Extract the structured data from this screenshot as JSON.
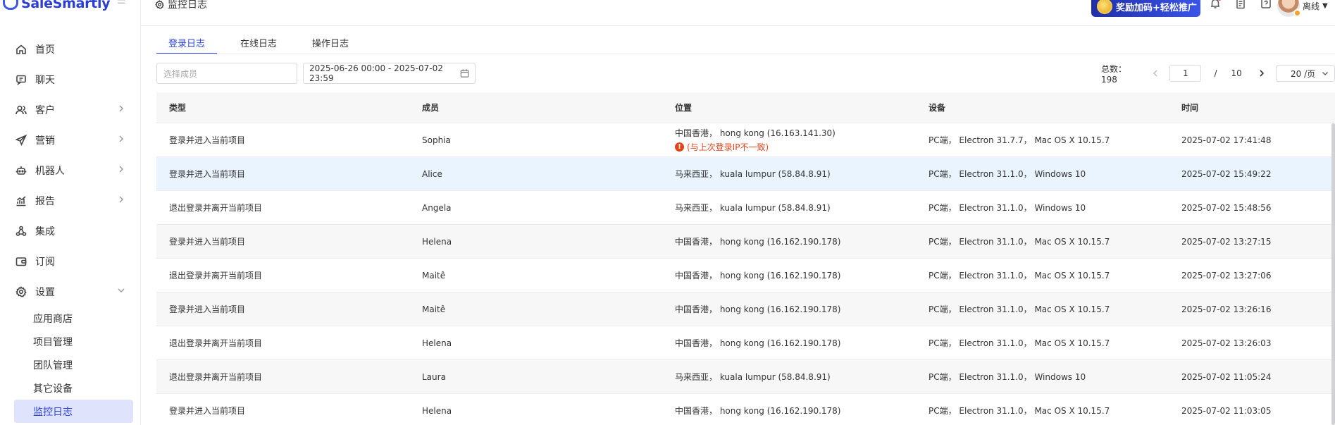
{
  "app": {
    "name": "SaleSmartly"
  },
  "sidebar": {
    "items": [
      {
        "label": "首页",
        "icon": "home-icon",
        "arrow": false
      },
      {
        "label": "聊天",
        "icon": "chat-icon",
        "arrow": false
      },
      {
        "label": "客户",
        "icon": "users-icon",
        "arrow": true
      },
      {
        "label": "营销",
        "icon": "send-icon",
        "arrow": true
      },
      {
        "label": "机器人",
        "icon": "robot-icon",
        "arrow": true
      },
      {
        "label": "报告",
        "icon": "report-icon",
        "arrow": true
      },
      {
        "label": "集成",
        "icon": "integration-icon",
        "arrow": false
      },
      {
        "label": "订阅",
        "icon": "wallet-icon",
        "arrow": false
      },
      {
        "label": "设置",
        "icon": "gear-icon",
        "arrow": "down"
      }
    ],
    "settings_sub": [
      {
        "label": "应用商店",
        "active": false
      },
      {
        "label": "项目管理",
        "active": false
      },
      {
        "label": "团队管理",
        "active": false
      },
      {
        "label": "其它设备",
        "active": false
      },
      {
        "label": "监控日志",
        "active": true
      }
    ]
  },
  "header": {
    "breadcrumb": "监控日志",
    "promo": "奖励加码+轻松推广",
    "status": "离线"
  },
  "tabs": [
    {
      "label": "登录日志",
      "active": true
    },
    {
      "label": "在线日志",
      "active": false
    },
    {
      "label": "操作日志",
      "active": false
    }
  ],
  "filters": {
    "member_placeholder": "选择成员",
    "date_range": "2025-06-26 00:00 - 2025-07-02 23:59"
  },
  "pager": {
    "total_label": "总数：198",
    "current": "1",
    "sep": "/",
    "pages": "10",
    "size": "20 /页"
  },
  "table": {
    "headers": [
      "类型",
      "成员",
      "位置",
      "设备",
      "时间"
    ],
    "rows": [
      {
        "type": "登录并进入当前项目",
        "member": "Sophia",
        "location": "中国香港，  hong kong (16.163.141.30)",
        "warning": "(与上次登录IP不一致)",
        "device": "PC端，  Electron 31.7.7，  Mac OS X 10.15.7",
        "time": "2025-07-02 17:41:48"
      },
      {
        "type": "登录并进入当前项目",
        "member": "Alice",
        "location": "马来西亚，  kuala lumpur (58.84.8.91)",
        "warning": "",
        "device": "PC端，  Electron 31.1.0，  Windows 10",
        "time": "2025-07-02 15:49:22"
      },
      {
        "type": "退出登录并离开当前项目",
        "member": "Angela",
        "location": "马来西亚，  kuala lumpur (58.84.8.91)",
        "warning": "",
        "device": "PC端，  Electron 31.1.0，  Windows 10",
        "time": "2025-07-02 15:48:56"
      },
      {
        "type": "登录并进入当前项目",
        "member": "Helena",
        "location": "中国香港，  hong kong (16.162.190.178)",
        "warning": "",
        "device": "PC端，  Electron 31.1.0，  Mac OS X 10.15.7",
        "time": "2025-07-02 13:27:15"
      },
      {
        "type": "退出登录并离开当前项目",
        "member": "Maitê",
        "location": "中国香港，  hong kong (16.162.190.178)",
        "warning": "",
        "device": "PC端，  Electron 31.1.0，  Mac OS X 10.15.7",
        "time": "2025-07-02 13:27:06"
      },
      {
        "type": "登录并进入当前项目",
        "member": "Maitê",
        "location": "中国香港，  hong kong (16.162.190.178)",
        "warning": "",
        "device": "PC端，  Electron 31.1.0，  Mac OS X 10.15.7",
        "time": "2025-07-02 13:26:16"
      },
      {
        "type": "退出登录并离开当前项目",
        "member": "Helena",
        "location": "中国香港，  hong kong (16.162.190.178)",
        "warning": "",
        "device": "PC端，  Electron 31.1.0，  Mac OS X 10.15.7",
        "time": "2025-07-02 13:26:03"
      },
      {
        "type": "退出登录并离开当前项目",
        "member": "Laura",
        "location": "马来西亚，  kuala lumpur (58.84.8.91)",
        "warning": "",
        "device": "PC端，  Electron 31.1.0，  Windows 10",
        "time": "2025-07-02 11:05:24"
      },
      {
        "type": "登录并进入当前项目",
        "member": "Helena",
        "location": "中国香港，  hong kong (16.162.190.178)",
        "warning": "",
        "device": "PC端，  Electron 31.1.0，  Mac OS X 10.15.7",
        "time": "2025-07-02 11:03:05"
      }
    ]
  },
  "colors": {
    "accent": "#2b44e0",
    "warning": "#e2451c",
    "row_highlight": "#eaf4ff"
  }
}
